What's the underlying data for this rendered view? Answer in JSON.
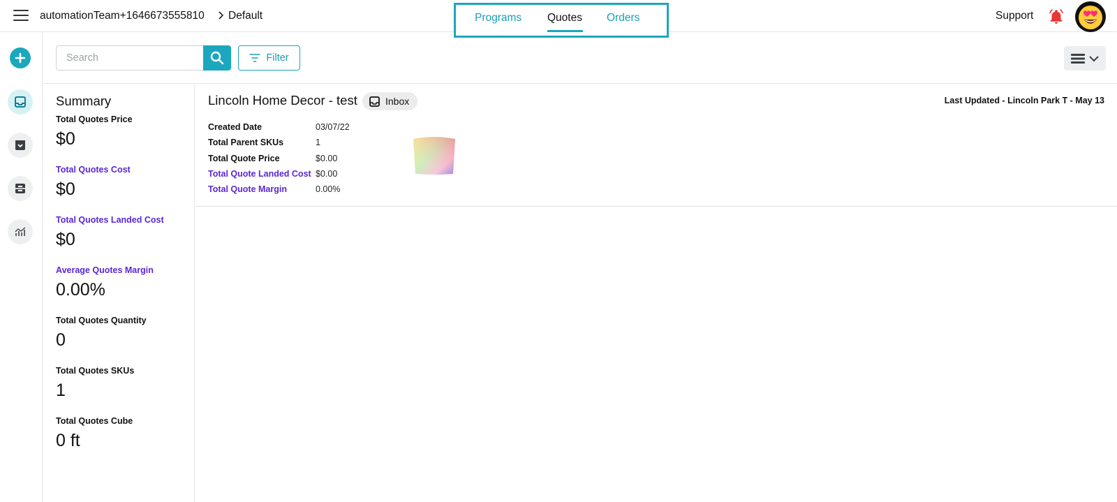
{
  "header": {
    "account": "automationTeam+1646673555810",
    "current": "Default",
    "tabs": [
      {
        "label": "Programs"
      },
      {
        "label": "Quotes"
      },
      {
        "label": "Orders"
      }
    ],
    "support_label": "Support"
  },
  "rail": {
    "icons": [
      "add-icon",
      "inbox-icon",
      "archive-icon",
      "tray-icon",
      "analytics-icon"
    ]
  },
  "toolbar": {
    "search_placeholder": "Search",
    "filter_label": "Filter"
  },
  "summary": {
    "title": "Summary",
    "stats": [
      {
        "label": "Total Quotes Price",
        "value": "$0"
      },
      {
        "label": "Total Quotes Cost",
        "value": "$0"
      },
      {
        "label": "Total Quotes Landed Cost",
        "value": "$0"
      },
      {
        "label": "Average Quotes Margin",
        "value": "0.00%"
      },
      {
        "label": "Total Quotes Quantity",
        "value": "0"
      },
      {
        "label": "Total Quotes SKUs",
        "value": "1"
      },
      {
        "label": "Total Quotes Cube",
        "value": "0 ft"
      }
    ]
  },
  "quote": {
    "title": "Lincoln Home Decor - test",
    "status": "Inbox",
    "last_updated": "Last Updated - Lincoln Park T - May 13",
    "fields": [
      {
        "label": "Created Date",
        "value": "03/07/22"
      },
      {
        "label": "Total Parent SKUs",
        "value": "1"
      },
      {
        "label": "Total Quote Price",
        "value": "$0.00"
      },
      {
        "label": "Total Quote Landed Cost",
        "value": "$0.00"
      },
      {
        "label": "Total Quote Margin",
        "value": "0.00%"
      }
    ]
  },
  "colors": {
    "accent": "#1ba7bd",
    "purple_label": "#5a26d6",
    "bell": "#e53935"
  }
}
